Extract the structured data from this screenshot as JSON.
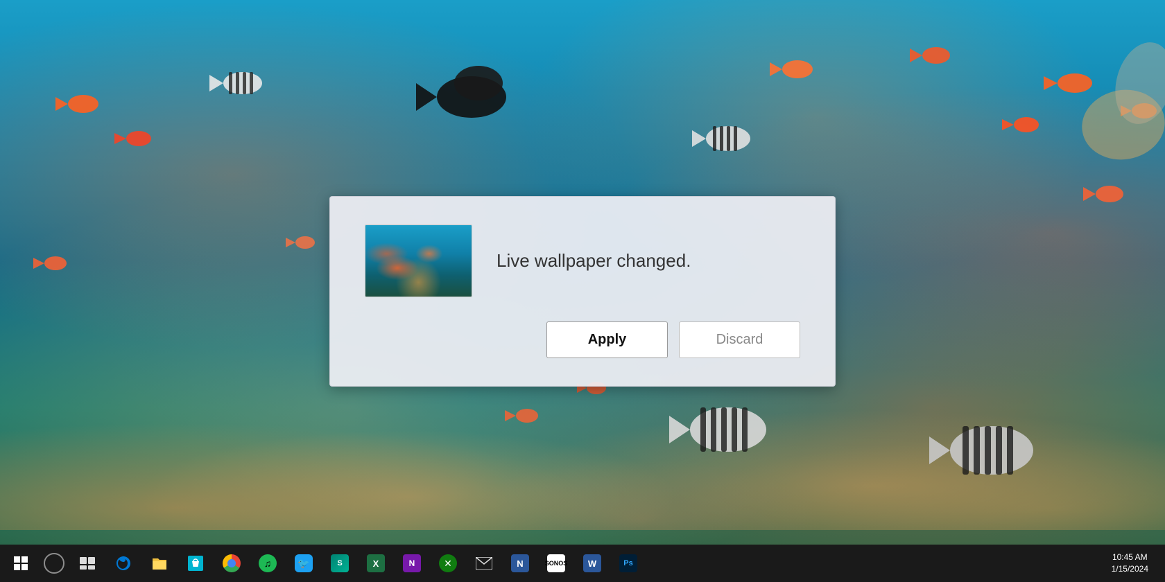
{
  "desktop": {
    "background_description": "Underwater coral reef with colorful fish"
  },
  "dialog": {
    "message": "Live wallpaper changed.",
    "apply_label": "Apply",
    "discard_label": "Discard",
    "thumbnail_alt": "Aquarium wallpaper thumbnail"
  },
  "taskbar": {
    "items": [
      {
        "name": "start",
        "label": "⊞",
        "tooltip": "Start"
      },
      {
        "name": "cortana",
        "label": "",
        "tooltip": "Cortana"
      },
      {
        "name": "task-view",
        "label": "",
        "tooltip": "Task View"
      },
      {
        "name": "edge",
        "label": "e",
        "tooltip": "Microsoft Edge"
      },
      {
        "name": "file-explorer",
        "label": "📁",
        "tooltip": "File Explorer"
      },
      {
        "name": "store",
        "label": "🛍",
        "tooltip": "Microsoft Store"
      },
      {
        "name": "chrome",
        "label": "",
        "tooltip": "Google Chrome"
      },
      {
        "name": "spotify",
        "label": "♫",
        "tooltip": "Spotify"
      },
      {
        "name": "twitter",
        "label": "🐦",
        "tooltip": "Twitter"
      },
      {
        "name": "sway",
        "label": "S",
        "tooltip": "Sway"
      },
      {
        "name": "excel",
        "label": "X",
        "tooltip": "Excel"
      },
      {
        "name": "onenote",
        "label": "N",
        "tooltip": "OneNote"
      },
      {
        "name": "xbox",
        "label": "✕",
        "tooltip": "Xbox"
      },
      {
        "name": "mail",
        "label": "✉",
        "tooltip": "Mail"
      },
      {
        "name": "onenote-n",
        "label": "N",
        "tooltip": "OneNote"
      },
      {
        "name": "sonos",
        "label": "S",
        "tooltip": "Sonos"
      },
      {
        "name": "word",
        "label": "W",
        "tooltip": "Word"
      },
      {
        "name": "photoshop",
        "label": "Ps",
        "tooltip": "Photoshop"
      }
    ],
    "clock": {
      "time": "10:45 AM",
      "date": "1/15/2024"
    }
  }
}
